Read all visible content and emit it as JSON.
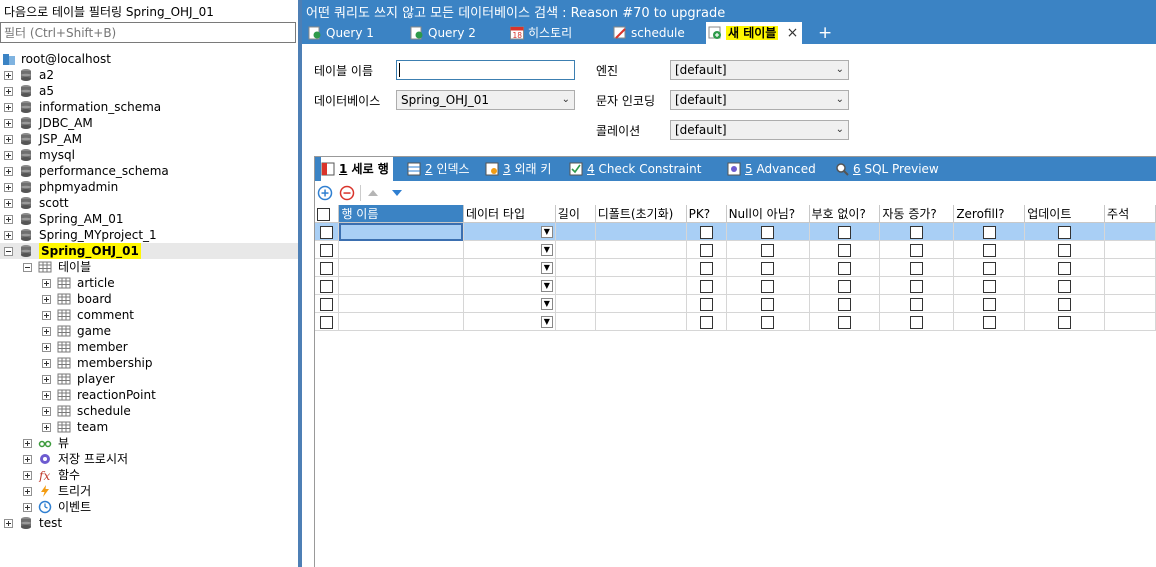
{
  "left": {
    "title": "다음으로 테이블 필터링 Spring_OHJ_01",
    "filter_placeholder": "필터 (Ctrl+Shift+B)",
    "tree": {
      "root": "root@localhost",
      "databases": [
        "a2",
        "a5",
        "information_schema",
        "JDBC_AM",
        "JSP_AM",
        "mysql",
        "performance_schema",
        "phpmyadmin",
        "scott",
        "Spring_AM_01",
        "Spring_MYproject_1"
      ],
      "selected_db": "Spring_OHJ_01",
      "tables_folder": "테이블",
      "tables": [
        "article",
        "board",
        "comment",
        "game",
        "member",
        "membership",
        "player",
        "reactionPoint",
        "schedule",
        "team"
      ],
      "other_folders": [
        "뷰",
        "저장 프로시저",
        "함수",
        "트리거",
        "이벤트"
      ],
      "last_db": "test"
    }
  },
  "right": {
    "tip": "어떤 쿼리도 쓰지 않고 모든 데이터베이스 검색 : Reason #70 to upgrade",
    "tabs": [
      {
        "label": "Query 1",
        "icon": "query-icon"
      },
      {
        "label": "Query 2",
        "icon": "query-icon"
      },
      {
        "label": "히스토리",
        "icon": "calendar-icon",
        "badge": "18"
      },
      {
        "label": "schedule",
        "icon": "table-edit-icon"
      },
      {
        "label": "새 테이블",
        "icon": "new-table-icon",
        "active": true
      }
    ],
    "add_tab": "+",
    "close_tab": "×",
    "form": {
      "table_name_label": "테이블 이름",
      "table_name_value": "",
      "database_label": "데이터베이스",
      "database_value": "Spring_OHJ_01",
      "engine_label": "엔진",
      "engine_value": "[default]",
      "charset_label": "문자 인코딩",
      "charset_value": "[default]",
      "collation_label": "콜레이션",
      "collation_value": "[default]"
    },
    "subtabs": [
      {
        "num": "1",
        "label": "세로 행",
        "active": true
      },
      {
        "num": "2",
        "label": "인덱스"
      },
      {
        "num": "3",
        "label": "외래 키"
      },
      {
        "num": "4",
        "label": "Check Constraint"
      },
      {
        "num": "5",
        "label": "Advanced"
      },
      {
        "num": "6",
        "label": "SQL Preview"
      }
    ],
    "grid": {
      "headers": [
        "행 이름",
        "데이터 타입",
        "길이",
        "디폴트(초기화)",
        "PK?",
        "Null이 아님?",
        "부호 없이?",
        "자동 증가?",
        "Zerofill?",
        "업데이트",
        "주석"
      ],
      "row_count": 6
    }
  }
}
